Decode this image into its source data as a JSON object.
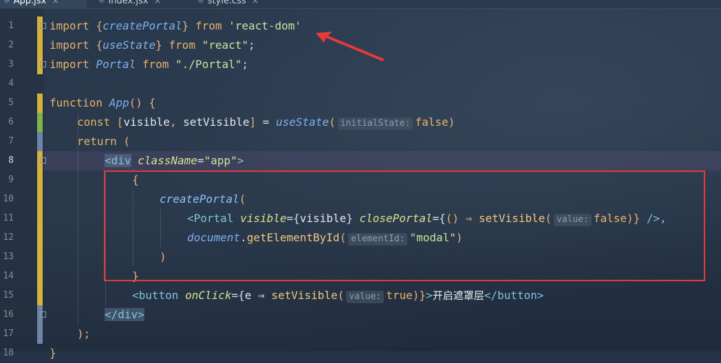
{
  "tabs": [
    {
      "label": "App.jsx",
      "close": "×",
      "active": true
    },
    {
      "label": "index.jsx",
      "close": "×",
      "active": false
    },
    {
      "label": "style.css",
      "close": "×",
      "active": false
    }
  ],
  "line_numbers": [
    "1",
    "2",
    "3",
    "4",
    "5",
    "6",
    "7",
    "8",
    "9",
    "10",
    "11",
    "12",
    "13",
    "14",
    "15",
    "16",
    "17",
    "18"
  ],
  "current_line": "8",
  "code": {
    "l1": {
      "kw": "import ",
      "b1": "{",
      "name": "createPortal",
      "b2": "}",
      "from": " from ",
      "str": "'react-dom'"
    },
    "l2": {
      "kw": "import ",
      "b1": "{",
      "name": "useState",
      "b2": "}",
      "from": " from ",
      "str": "\"react\"",
      "semi": ";"
    },
    "l3": {
      "kw": "import ",
      "name": "Portal",
      "from": " from ",
      "str": "\"./Portal\"",
      "semi": ";"
    },
    "l5": {
      "kw": "function ",
      "name": "App",
      "rest": "() {"
    },
    "l6": {
      "kw": "const ",
      "b1": "[",
      "v1": "visible",
      "comma": ", ",
      "v2": "setVisible",
      "b2": "]",
      "eq": " = ",
      "fn": "useState",
      "open": "(",
      "hint": "initialState:",
      "val": "false",
      "close": ")"
    },
    "l7": {
      "kw": "return",
      "rest": " ("
    },
    "l8": {
      "open": "<",
      "tag": "div",
      "attr": "className",
      "eq": "=",
      "str": "\"app\"",
      "close": ">"
    },
    "l9": {
      "text": "{"
    },
    "l10": {
      "fn": "createPortal",
      "open": "("
    },
    "l11": {
      "open": "<",
      "tag": "Portal",
      "attr1": "visible",
      "eq1": "={",
      "v1": "visible",
      "c1": "}",
      "attr2": "closePortal",
      "eq2": "={",
      "arrow": "() ⇒ ",
      "call": "setVisible",
      "p1": "(",
      "hint": "value:",
      "val": "false",
      "p2": ")}",
      "end": " />,"
    },
    "l12": {
      "obj": "document",
      "dot": ".",
      "call": "getElementById",
      "p1": "(",
      "hint": "elementId:",
      "str": "\"modal\"",
      "p2": ")"
    },
    "l13": {
      "text": ")"
    },
    "l14": {
      "text": "}"
    },
    "l15": {
      "open": "<",
      "tag": "button",
      "attr": "onClick",
      "eq": "={",
      "arrow": "e ⇒ ",
      "call": "setVisible",
      "p1": "(",
      "hint": "value:",
      "val": "true",
      "p2": ")}",
      "gt": ">",
      "text": "开启遮罩层",
      "close_open": "</",
      "close_tag": "button",
      "close_gt": ">"
    },
    "l16": {
      "open": "</",
      "tag": "div",
      "close": ">"
    },
    "l17": {
      "text": ");"
    },
    "l18": {
      "text": "}"
    }
  },
  "colors": {
    "annotation_red": "#e53a3a",
    "keyword": "#e8b36a",
    "string": "#c9e59a"
  }
}
